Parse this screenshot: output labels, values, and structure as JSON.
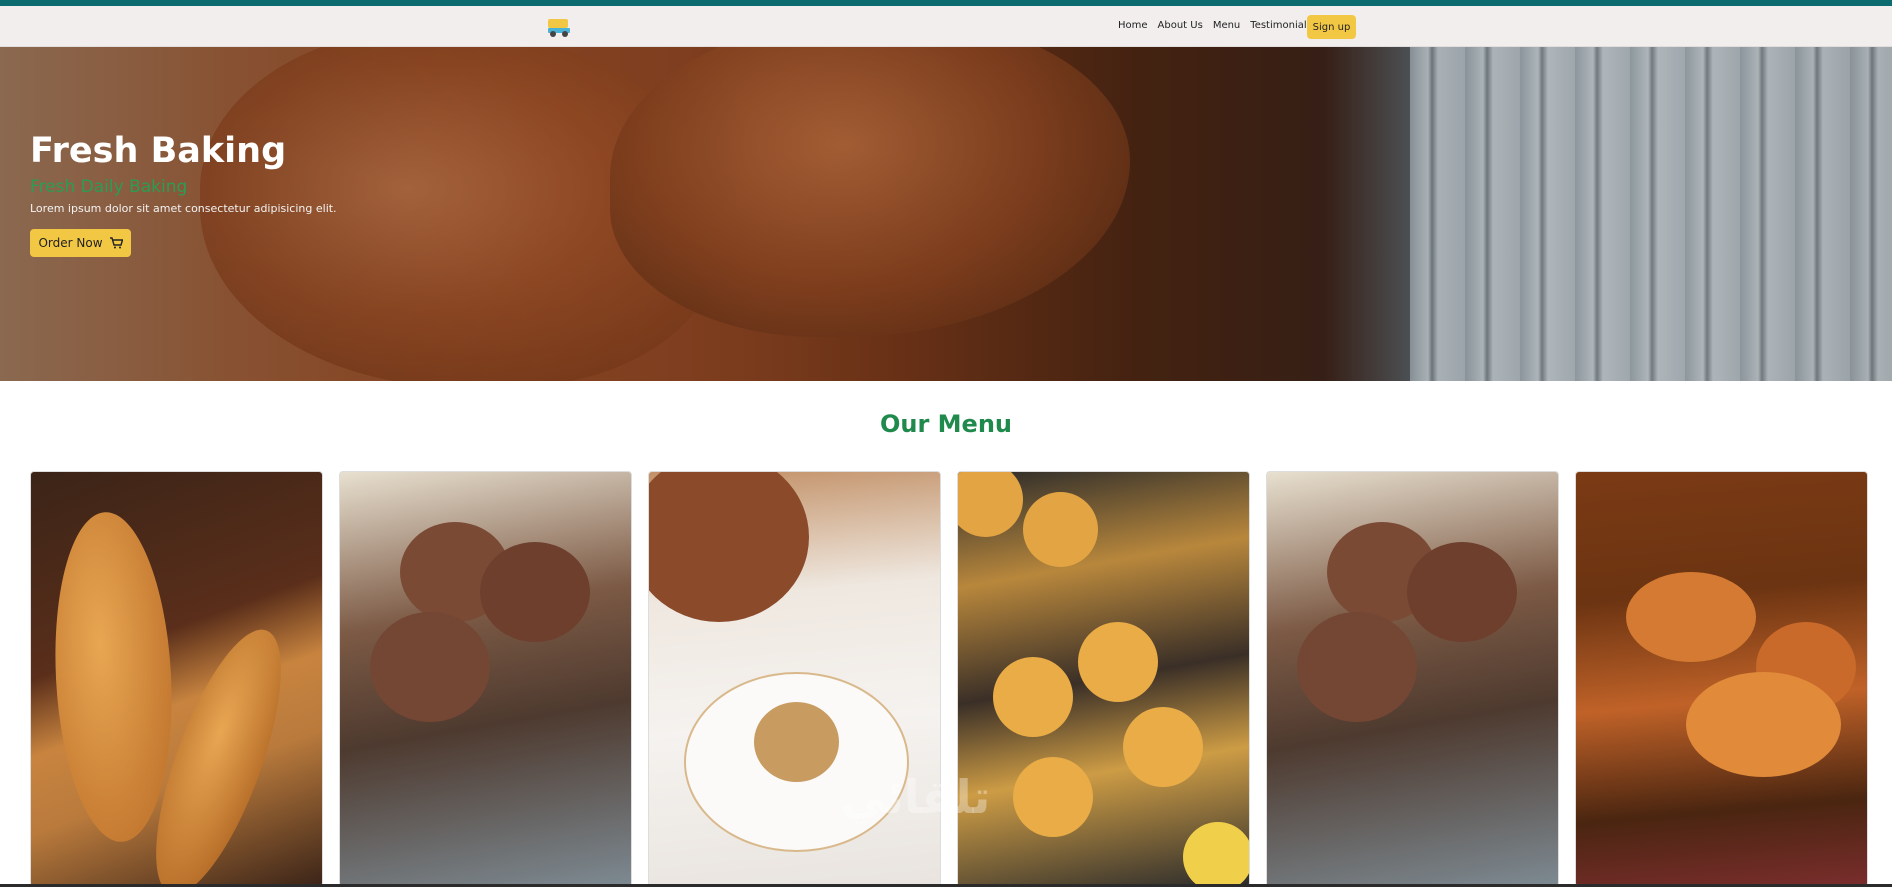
{
  "nav": {
    "links": [
      "Home",
      "About Us",
      "Menu",
      "Testimonial"
    ],
    "signup_label": "Sign up"
  },
  "hero": {
    "title": "Fresh Baking",
    "subtitle": "Fresh Daily Baking",
    "text": "Lorem ipsum dolor sit amet consectetur adipisicing elit.",
    "order_label": "Order Now",
    "order_icon": "cart-icon"
  },
  "menu": {
    "title": "Our Menu",
    "items": [
      {
        "image": "baguettes-photo"
      },
      {
        "image": "blueberry-muffins-photo"
      },
      {
        "image": "cupcake-on-plate-photo"
      },
      {
        "image": "muffins-top-view-photo"
      },
      {
        "image": "blueberry-muffins-photo"
      },
      {
        "image": "croissants-photo"
      }
    ]
  },
  "colors": {
    "topstrip": "#0c6b6f",
    "accent": "#f2c744",
    "green": "#1f8a4c"
  },
  "watermark": "تلقائي"
}
